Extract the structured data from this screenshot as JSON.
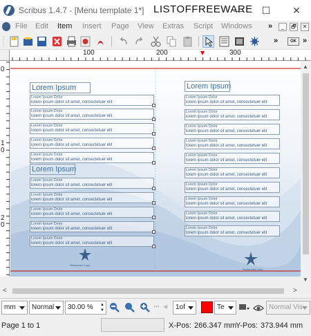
{
  "window": {
    "title": "Scribus 1.4.7 - [Menu template 1*]",
    "watermark": "LISTOFFREEWARE",
    "minimize": "—",
    "maximize": "☐",
    "close": "✕"
  },
  "menubar": {
    "items": [
      "File",
      "Edit",
      "Item",
      "Insert",
      "Page",
      "View",
      "Extras",
      "Script",
      "Windows"
    ],
    "overflow": "»",
    "mdi_min": "_",
    "mdi_restore": "🗗",
    "mdi_close": "✕"
  },
  "toolbar": {
    "overflow_left": "»",
    "overflow_right": "»",
    "ok_label": "OK"
  },
  "ruler": {
    "h_labels": [
      "100",
      "200",
      "300"
    ],
    "v_labels": [
      "0",
      "1",
      "0",
      "2",
      "0"
    ]
  },
  "document": {
    "heading": "Lorem Ipsum",
    "entry_caption": "Lorem Ipsum Dolor",
    "entry_text": "lorem ipsum dolor sit amet, consectetuer elit",
    "logo_text": "Restaurant Logo"
  },
  "statusbar": {
    "unit": "mm",
    "quality": "Normal",
    "zoom": "30.00 %",
    "page_of": "1of",
    "layer_label": "Te",
    "view_mode": "Normal Vis",
    "page_info": "Page 1 to 1",
    "xpos_label": "X-Pos:",
    "xpos_value": "266.347 mm",
    "ypos_label": "Y-Pos:",
    "ypos_value": "373.944 mm"
  },
  "colors": {
    "accent_red": "#ff0000",
    "text_blue": "#3a6fb0",
    "bg_gradient_top": "#ffffff",
    "bg_gradient_bottom": "#c9d8e8"
  }
}
